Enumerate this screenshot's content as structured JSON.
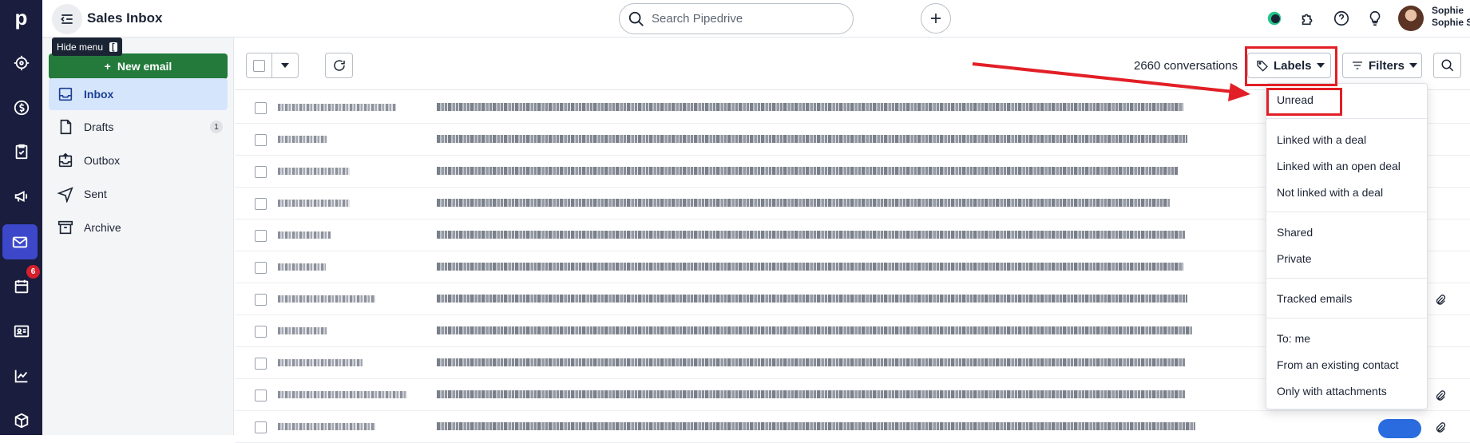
{
  "app": {
    "logo_letter": "p",
    "title": "Sales Inbox"
  },
  "rail": {
    "items": [
      "target-icon",
      "dollar-icon",
      "clipboard-check-icon",
      "megaphone-icon",
      "mail-icon",
      "calendar-icon",
      "contact-card-icon",
      "chart-line-icon",
      "box-icon"
    ],
    "active": "mail-icon",
    "calendar_badge": "6"
  },
  "search": {
    "placeholder": "Search Pipedrive"
  },
  "user": {
    "name": "Sophie",
    "full_name": "Sophie S"
  },
  "tooltip": {
    "label": "Hide menu",
    "shortcut": "["
  },
  "sidebar": {
    "new_email_label": "New email",
    "folders": [
      {
        "label": "Inbox",
        "icon": "inbox-icon",
        "active": true
      },
      {
        "label": "Drafts",
        "icon": "document-icon",
        "count": "1"
      },
      {
        "label": "Outbox",
        "icon": "outbox-icon"
      },
      {
        "label": "Sent",
        "icon": "send-icon"
      },
      {
        "label": "Archive",
        "icon": "archive-icon"
      }
    ]
  },
  "toolbar": {
    "conversation_count": "2660 conversations",
    "labels_label": "Labels",
    "filters_label": "Filters"
  },
  "labels_menu": {
    "items": [
      "Unread",
      "Linked with a deal",
      "Linked with an open deal",
      "Not linked with a deal",
      "Shared",
      "Private",
      "Tracked emails",
      "To: me",
      "From an existing contact",
      "Only with attachments"
    ],
    "highlighted": "Unread"
  },
  "colors": {
    "rail_bg": "#1a1d3d",
    "rail_active": "#3c48c9",
    "primary_button": "#237a3b",
    "active_folder_bg": "#d5e5fb",
    "annotation_red": "#e21f26"
  },
  "email_rows": {
    "count": 11,
    "note_visible": "blurred"
  }
}
